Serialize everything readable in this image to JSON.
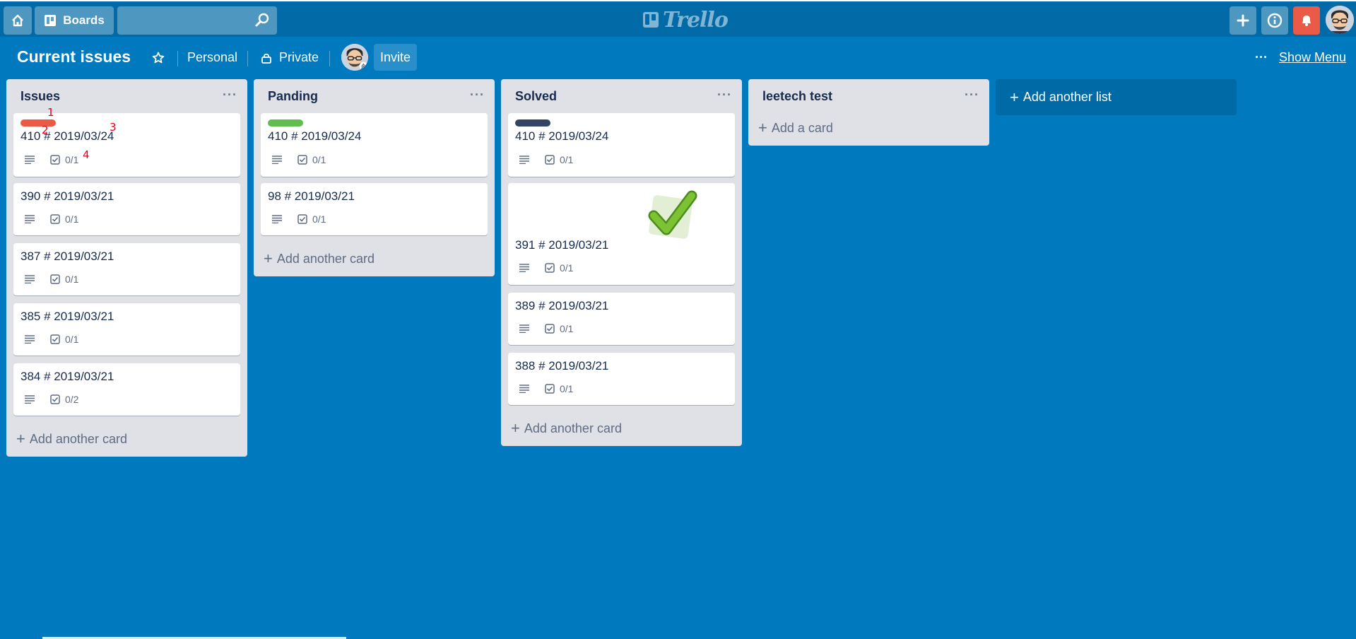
{
  "header": {
    "boards_label": "Boards",
    "search_value": "",
    "logo_text": "Trello",
    "icons": [
      "home-icon",
      "board-icon",
      "search-icon",
      "plus-icon",
      "info-icon",
      "bell-icon"
    ]
  },
  "board": {
    "title": "Current issues",
    "team": "Personal",
    "visibility": "Private",
    "invite_label": "Invite",
    "menu_label": "Show Menu",
    "menu_dots": "···",
    "colors": {
      "background": "#0079bf",
      "header": "#026aa7",
      "list_bg": "#dfe1e6",
      "notification": "#eb5a46"
    }
  },
  "lists": [
    {
      "title": "Issues",
      "cards": [
        {
          "label_color": "#eb5a46",
          "title": "410 # 2019/03/24",
          "checklist": "0/1"
        },
        {
          "title": "390 # 2019/03/21",
          "checklist": "0/1"
        },
        {
          "title": "387 # 2019/03/21",
          "checklist": "0/1"
        },
        {
          "title": "385 # 2019/03/21",
          "checklist": "0/1"
        },
        {
          "title": "384 # 2019/03/21",
          "checklist": "0/2"
        }
      ],
      "add_card_label": "Add another card"
    },
    {
      "title": "Panding",
      "cards": [
        {
          "label_color": "#61bd4f",
          "title": "410 # 2019/03/24",
          "checklist": "0/1"
        },
        {
          "title": "98 # 2019/03/21",
          "checklist": "0/1"
        }
      ],
      "add_card_label": "Add another card"
    },
    {
      "title": "Solved",
      "cards": [
        {
          "label_color": "#344563",
          "title": "410 # 2019/03/24",
          "checklist": "0/1"
        },
        {
          "cover": "green-checkmark",
          "title": "391 # 2019/03/21",
          "checklist": "0/1"
        },
        {
          "title": "389 # 2019/03/21",
          "checklist": "0/1"
        },
        {
          "title": "388 # 2019/03/21",
          "checklist": "0/1"
        }
      ],
      "add_card_label": "Add another card"
    },
    {
      "title": "leetech test",
      "cards": [],
      "add_card_label": "Add a card"
    }
  ],
  "add_list_label": "Add another list",
  "annotations": [
    "1",
    "2",
    "3",
    "4"
  ]
}
